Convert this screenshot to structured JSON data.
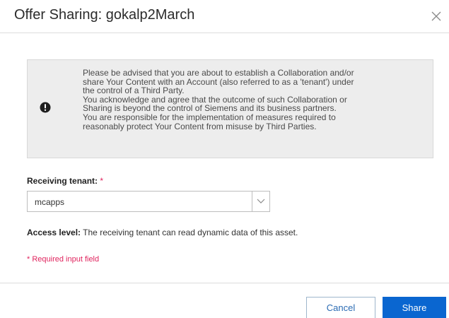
{
  "dialog": {
    "title": "Offer Sharing: gokalp2March",
    "close_icon": "close-icon"
  },
  "notice": {
    "icon": "exclamation-icon",
    "lines": [
      "Please be advised that you are about to establish a Collaboration and/or",
      "share Your Content with an Account (also referred to as a 'tenant') under",
      "the control of a Third Party.",
      "You acknowledge and agree that the outcome of such Collaboration or",
      "Sharing is beyond the control of Siemens and its business partners.",
      "You are responsible for the implementation of measures required to",
      "reasonably protect Your Content from misuse by Third Parties."
    ]
  },
  "receiving_tenant": {
    "label": "Receiving tenant:",
    "required_mark": "*",
    "value": "mcapps"
  },
  "access": {
    "label": "Access level:",
    "text": " The receiving tenant can read dynamic data of this asset."
  },
  "required_note": "* Required input field",
  "footer": {
    "cancel_label": "Cancel",
    "share_label": "Share"
  },
  "colors": {
    "primary": "#0a66d0",
    "required": "#e0245e",
    "notice_bg": "#ededed"
  }
}
